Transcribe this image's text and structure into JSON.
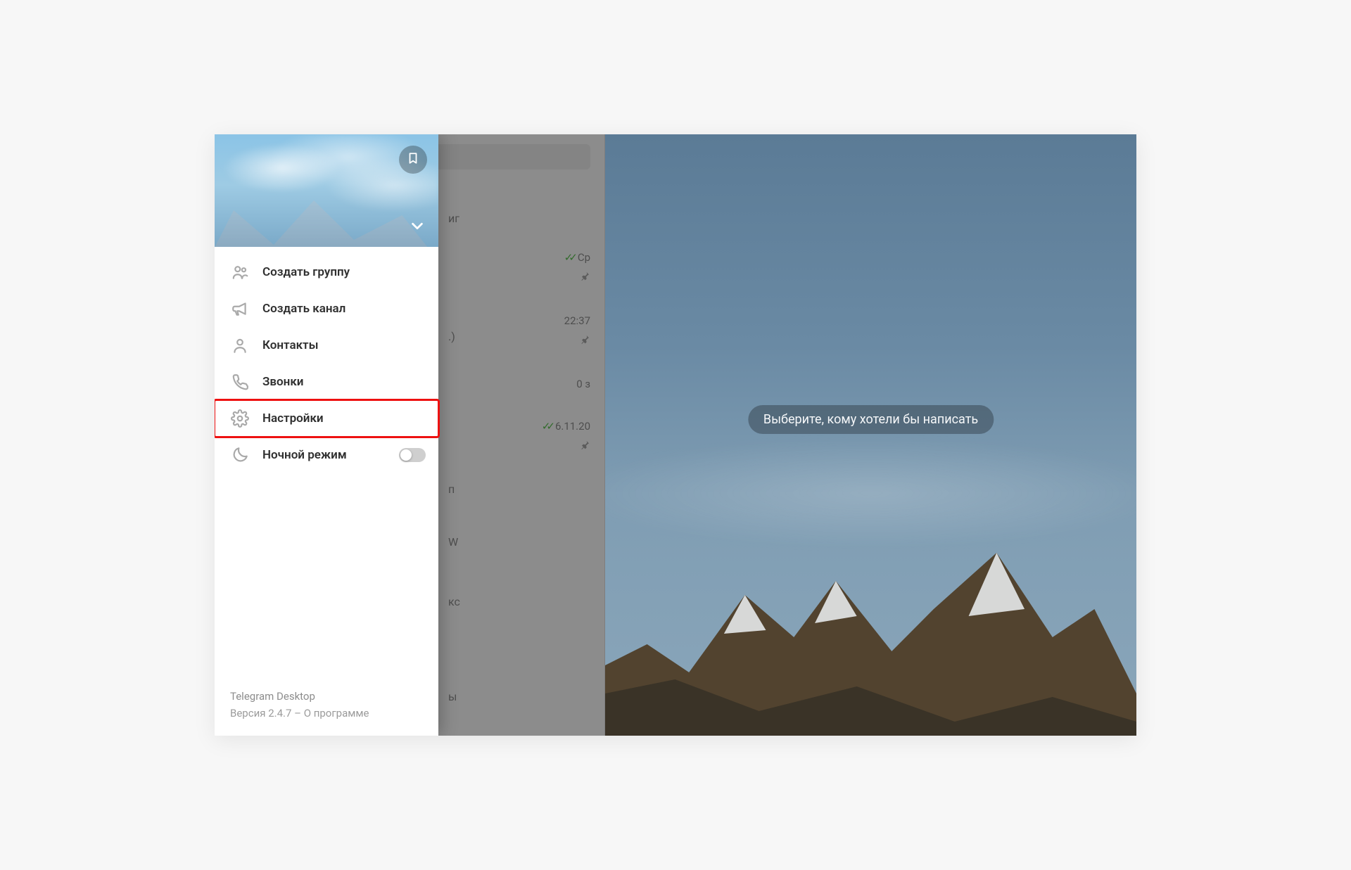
{
  "main": {
    "empty_hint": "Выберите, кому хотели бы написать"
  },
  "chatlist": {
    "rows": [
      {
        "time": "Ср",
        "ticks": true,
        "pinned": true
      },
      {
        "time": "22:37",
        "ticks": false,
        "pinned": true
      },
      {
        "time": "0 з",
        "ticks": false,
        "pinned": false
      },
      {
        "time": "6.11.20",
        "ticks": true,
        "pinned": true
      }
    ],
    "fragments": [
      "иг",
      ".)",
      "п",
      "W",
      "кс",
      "ы"
    ]
  },
  "drawer": {
    "menu": [
      {
        "id": "new-group",
        "label": "Создать группу",
        "icon": "group-icon"
      },
      {
        "id": "new-channel",
        "label": "Создать канал",
        "icon": "megaphone-icon"
      },
      {
        "id": "contacts",
        "label": "Контакты",
        "icon": "person-icon"
      },
      {
        "id": "calls",
        "label": "Звонки",
        "icon": "phone-icon"
      },
      {
        "id": "settings",
        "label": "Настройки",
        "icon": "gear-icon",
        "highlighted": true
      },
      {
        "id": "night-mode",
        "label": "Ночной режим",
        "icon": "moon-icon",
        "toggle": true,
        "toggle_on": false
      }
    ],
    "footer": {
      "app_name": "Telegram Desktop",
      "version_prefix": "Версия ",
      "version": "2.4.7",
      "sep": " – ",
      "about": "О программе"
    }
  }
}
